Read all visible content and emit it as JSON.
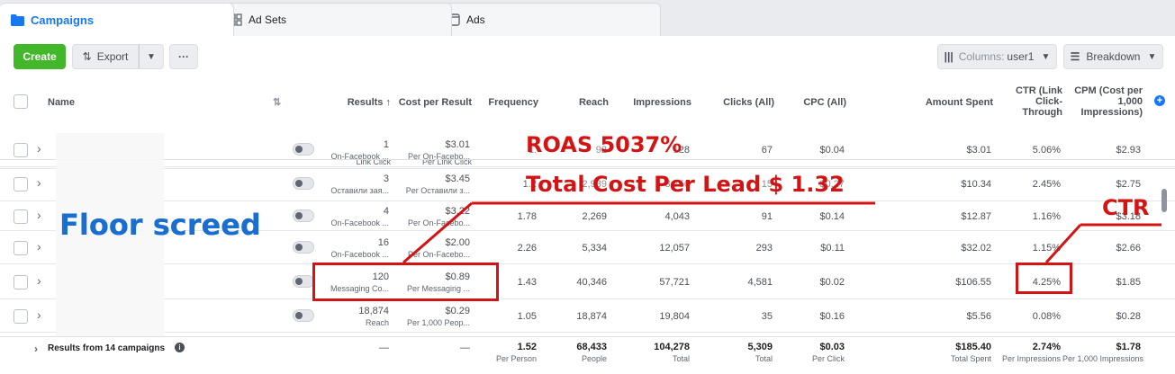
{
  "tabs": [
    {
      "label": "Campaigns",
      "icon": "folder-icon"
    },
    {
      "label": "Ad Sets",
      "icon": "grid-icon"
    },
    {
      "label": "Ads",
      "icon": "ad-icon"
    }
  ],
  "toolbar": {
    "create_label": "Create",
    "export_label": "Export",
    "more_label": "···",
    "columns_prefix": "Columns:",
    "columns_value": "user1",
    "breakdown_label": "Breakdown"
  },
  "headers": {
    "name": "Name",
    "results": "Results",
    "cost_per_result": "Cost per Result",
    "frequency": "Frequency",
    "reach": "Reach",
    "impressions": "Impressions",
    "clicks": "Clicks (All)",
    "cpc": "CPC (All)",
    "amount_spent": "Amount Spent",
    "ctr_line1": "CTR (Link",
    "ctr_line2": "Click-",
    "ctr_line3": "Through",
    "cpm_line1": "CPM (Cost per",
    "cpm_line2": "1,000",
    "cpm_line3": "Impressions)"
  },
  "partial_row": {
    "results_sub": "Link Click",
    "cost_sub": "Per Link Click"
  },
  "rows": [
    {
      "results": "1",
      "results_sub": "On-Facebook ...",
      "cost": "$3.01",
      "cost_sub": "Per On-Facebo...",
      "frequency": "1.",
      "reach": "92",
      "impressions": "128",
      "clicks": "67",
      "cpc": "$0.04",
      "spent": "$3.01",
      "ctr": "5.06%",
      "cpm": "$2.93"
    },
    {
      "results": "3",
      "results_sub": "Оставили зая...",
      "cost": "$3.45",
      "cost_sub": "Per Оставили з...",
      "frequency": "1.2",
      "reach": "2,939",
      "impressions": "3,756",
      "clicks": "15",
      "cpc": "$0.27",
      "spent": "$10.34",
      "ctr": "2.45%",
      "cpm": "$2.75"
    },
    {
      "results": "4",
      "results_sub": "On-Facebook ...",
      "cost": "$3.22",
      "cost_sub": "Per On-Facebo...",
      "frequency": "1.78",
      "reach": "2,269",
      "impressions": "4,043",
      "clicks": "91",
      "cpc": "$0.14",
      "spent": "$12.87",
      "ctr": "1.16%",
      "cpm": "$3.18"
    },
    {
      "results": "16",
      "results_sub": "On-Facebook ...",
      "cost": "$2.00",
      "cost_sub": "Per On-Facebo...",
      "frequency": "2.26",
      "reach": "5,334",
      "impressions": "12,057",
      "clicks": "293",
      "cpc": "$0.11",
      "spent": "$32.02",
      "ctr": "1.15%",
      "cpm": "$2.66"
    },
    {
      "results": "120",
      "results_sub": "Messaging Co...",
      "cost": "$0.89",
      "cost_sub": "Per Messaging ...",
      "frequency": "1.43",
      "reach": "40,346",
      "impressions": "57,721",
      "clicks": "4,581",
      "cpc": "$0.02",
      "spent": "$106.55",
      "ctr": "4.25%",
      "cpm": "$1.85"
    },
    {
      "results": "18,874",
      "results_sub": "Reach",
      "cost": "$0.29",
      "cost_sub": "Per 1,000 Peop...",
      "frequency": "1.05",
      "reach": "18,874",
      "impressions": "19,804",
      "clicks": "35",
      "cpc": "$0.16",
      "spent": "$5.56",
      "ctr": "0.08%",
      "cpm": "$0.28"
    }
  ],
  "summary": {
    "label": "Results from 14 campaigns",
    "results": "—",
    "cost": "—",
    "frequency": "1.52",
    "frequency_sub": "Per Person",
    "reach": "68,433",
    "reach_sub": "People",
    "impressions": "104,278",
    "impressions_sub": "Total",
    "clicks": "5,309",
    "clicks_sub": "Total",
    "cpc": "$0.03",
    "cpc_sub": "Per Click",
    "spent": "$185.40",
    "spent_sub": "Total Spent",
    "ctr": "2.74%",
    "ctr_sub": "Per Impressions",
    "cpm": "$1.78",
    "cpm_sub": "Per 1,000 Impressions"
  },
  "annotations": {
    "roas": "ROAS 5037%",
    "cost_per_lead": "Total Cost Per Lead $ 1.32",
    "ctr": "CTR",
    "campaign_name": "Floor screed"
  },
  "colors": {
    "accent": "#1877f2",
    "create_green": "#42b72a",
    "annotation_red": "#d41414",
    "annotation_blue": "#1a6ed0"
  }
}
